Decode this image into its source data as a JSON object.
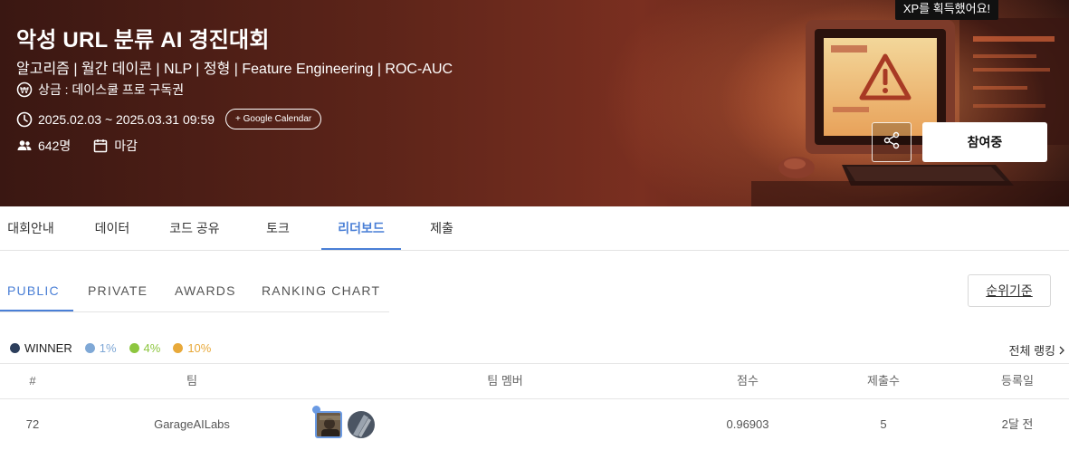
{
  "hero": {
    "title": "악성 URL 분류 AI 경진대회",
    "subtitle": "알고리즘 | 월간 데이콘 | NLP | 정형 | Feature Engineering | ROC-AUC",
    "prize": "상금 : 데이스쿨 프로 구독권",
    "period": "2025.02.03 ~ 2025.03.31 09:59",
    "calendar_button": "+ Google Calendar",
    "participants": "642명",
    "status": "마감",
    "xp_tooltip": "XP를 획득했어요!",
    "join_button": "참여중",
    "icons": {
      "prize": "won-coin-icon",
      "period": "clock-icon",
      "participants": "people-icon",
      "status": "calendar-icon",
      "share": "share-icon"
    }
  },
  "tabs": [
    {
      "label": "대회안내"
    },
    {
      "label": "데이터"
    },
    {
      "label": "코드 공유"
    },
    {
      "label": "토크"
    },
    {
      "label": "리더보드"
    },
    {
      "label": "제출"
    }
  ],
  "active_tab": "리더보드",
  "subtabs": [
    {
      "label": "PUBLIC"
    },
    {
      "label": "PRIVATE"
    },
    {
      "label": "AWARDS"
    },
    {
      "label": "RANKING CHART"
    }
  ],
  "active_subtab": "PUBLIC",
  "rank_criteria_button": "순위기준",
  "legend": [
    {
      "label": "WINNER",
      "color": "#2c3e5c"
    },
    {
      "label": "1%",
      "color": "#7fa8d6"
    },
    {
      "label": "4%",
      "color": "#8dc63f"
    },
    {
      "label": "10%",
      "color": "#e8a93a"
    }
  ],
  "all_ranking_link": "전체 랭킹",
  "table": {
    "headers": [
      "#",
      "팀",
      "팀 멤버",
      "점수",
      "제출수",
      "등록일"
    ],
    "rows": [
      {
        "rank": "72",
        "team": "GarageAILabs",
        "score": "0.96903",
        "submissions": "5",
        "registered": "2달 전"
      }
    ]
  },
  "colors": {
    "accent": "#4a7fd6",
    "hero_base": "#5c2419"
  }
}
